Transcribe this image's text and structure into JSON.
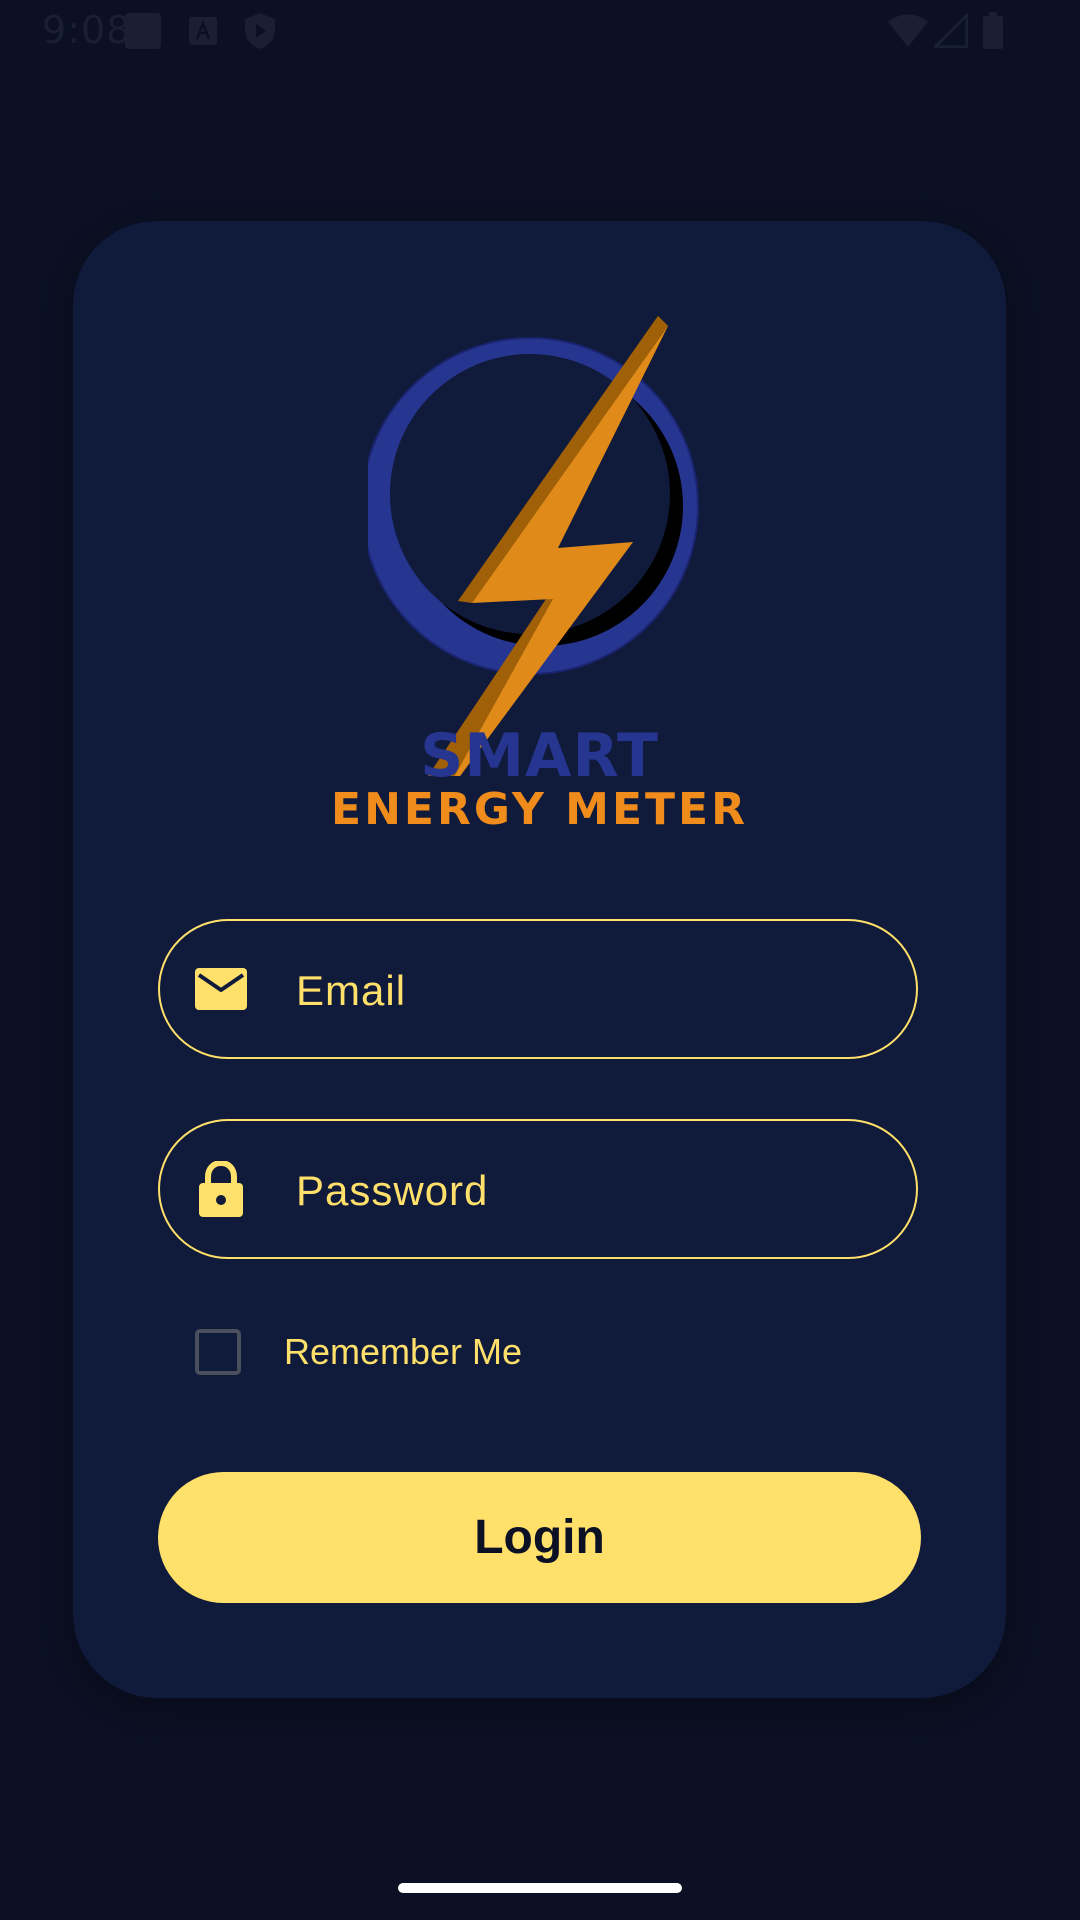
{
  "status_bar": {
    "time": "9:08",
    "icons": [
      "notification-square-icon",
      "a-icon",
      "shield-play-icon",
      "wifi-icon",
      "signal-icon",
      "battery-icon"
    ]
  },
  "brand": {
    "title": "SMART",
    "subtitle": "ENERGY METER",
    "title_color": "#26358f",
    "subtitle_color": "#f08c1c"
  },
  "form": {
    "email_placeholder": "Email",
    "password_placeholder": "Password",
    "remember_label": "Remember Me",
    "remember_checked": false,
    "login_label": "Login"
  },
  "colors": {
    "background": "#0b1024",
    "card": "#101a3a",
    "accent": "#ffe06a"
  }
}
